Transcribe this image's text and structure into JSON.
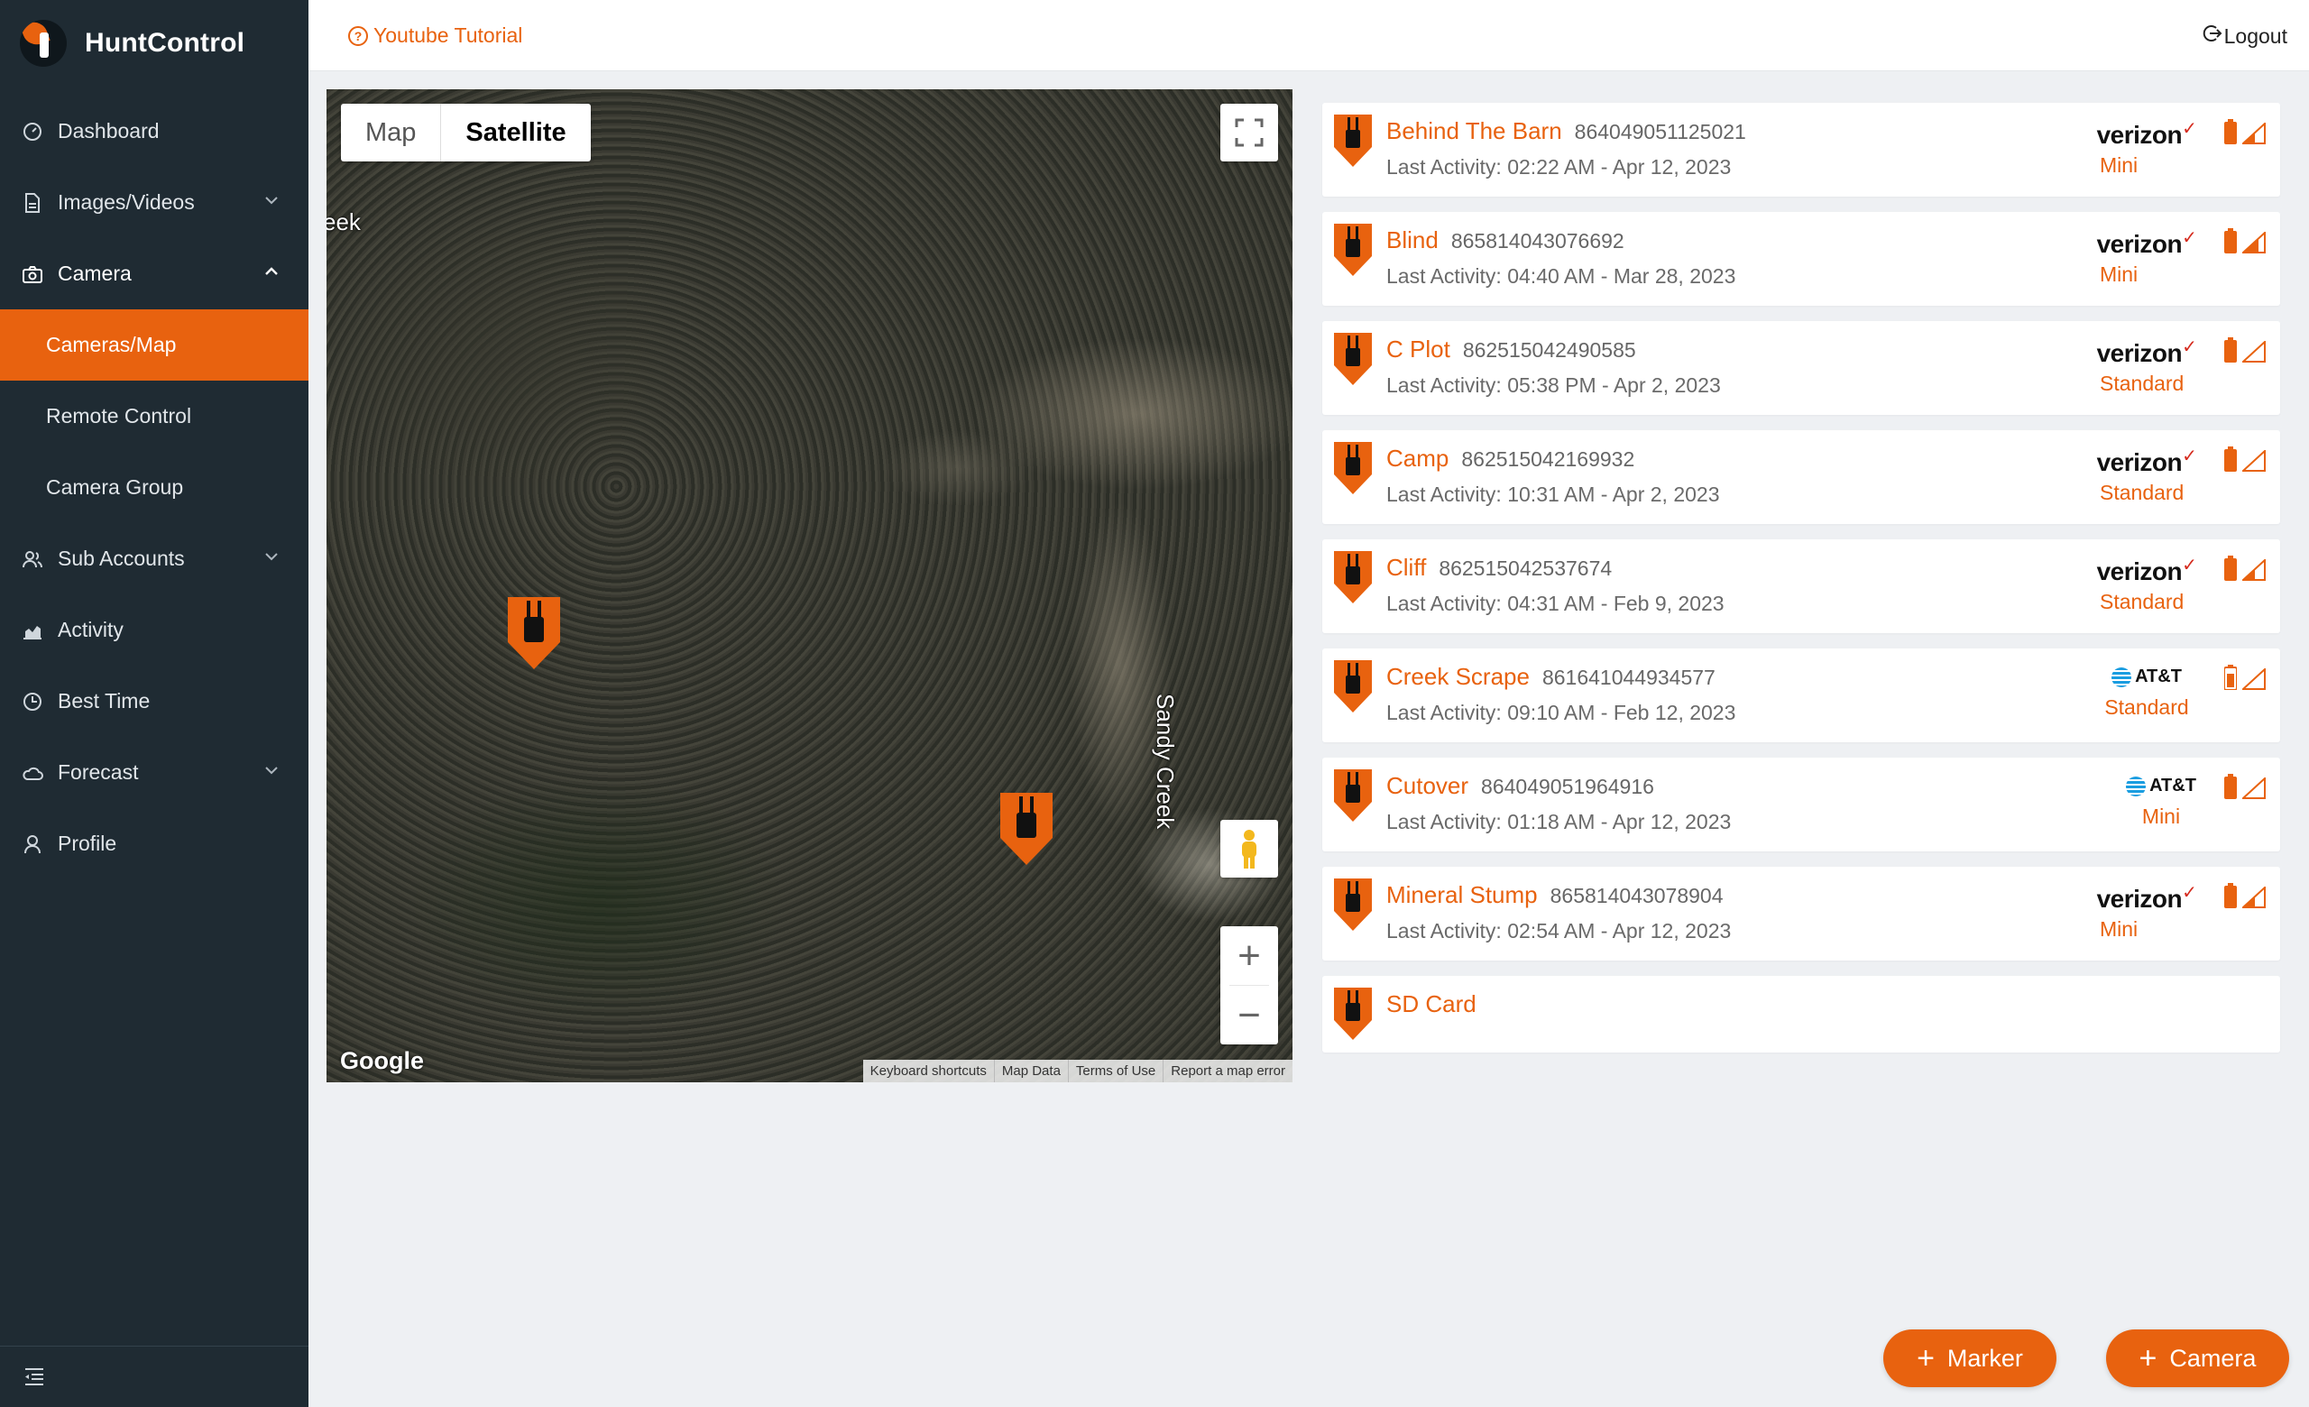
{
  "app": {
    "name": "HuntControl"
  },
  "colors": {
    "accent": "#e8620f",
    "sidebar": "#1f2b33"
  },
  "sidebar": {
    "items": [
      {
        "label": "Dashboard",
        "icon": "dashboard-icon"
      },
      {
        "label": "Images/Videos",
        "icon": "file-icon",
        "expandable": true
      },
      {
        "label": "Camera",
        "icon": "camera-icon",
        "expanded": true
      },
      {
        "label": "Cameras/Map",
        "active": true
      },
      {
        "label": "Remote Control"
      },
      {
        "label": "Camera Group"
      },
      {
        "label": "Sub Accounts",
        "icon": "users-icon",
        "expandable": true
      },
      {
        "label": "Activity",
        "icon": "chart-icon"
      },
      {
        "label": "Best Time",
        "icon": "clock-icon"
      },
      {
        "label": "Forecast",
        "icon": "cloud-icon",
        "expandable": true
      },
      {
        "label": "Profile",
        "icon": "user-icon"
      }
    ]
  },
  "topbar": {
    "tutorial": "Youtube Tutorial",
    "logout": "Logout"
  },
  "map": {
    "type_options": [
      "Map",
      "Satellite"
    ],
    "selected_type": "Satellite",
    "labels": {
      "creek": "eek",
      "sandy": "Sandy Creek"
    },
    "google": "Google",
    "attribution": [
      "Keyboard shortcuts",
      "Map Data",
      "Terms of Use",
      "Report a map error"
    ],
    "zoom_in": "+",
    "zoom_out": "−"
  },
  "cameras": [
    {
      "name": "Behind The Barn",
      "imei": "864049051125021",
      "activity": "Last Activity: 02:22 AM - Apr 12, 2023",
      "carrier": "verizon",
      "plan": "Mini"
    },
    {
      "name": "Blind",
      "imei": "865814043076692",
      "activity": "Last Activity: 04:40 AM - Mar 28, 2023",
      "carrier": "verizon",
      "plan": "Mini"
    },
    {
      "name": "C Plot",
      "imei": "862515042490585",
      "activity": "Last Activity: 05:38 PM - Apr 2, 2023",
      "carrier": "verizon",
      "plan": "Standard"
    },
    {
      "name": "Camp",
      "imei": "862515042169932",
      "activity": "Last Activity: 10:31 AM - Apr 2, 2023",
      "carrier": "verizon",
      "plan": "Standard"
    },
    {
      "name": "Cliff",
      "imei": "862515042537674",
      "activity": "Last Activity: 04:31 AM - Feb 9, 2023",
      "carrier": "verizon",
      "plan": "Standard"
    },
    {
      "name": "Creek Scrape",
      "imei": "861641044934577",
      "activity": "Last Activity: 09:10 AM - Feb 12, 2023",
      "carrier": "AT&T",
      "plan": "Standard"
    },
    {
      "name": "Cutover",
      "imei": "864049051964916",
      "activity": "Last Activity: 01:18 AM - Apr 12, 2023",
      "carrier": "AT&T",
      "plan": "Mini"
    },
    {
      "name": "Mineral Stump",
      "imei": "865814043078904",
      "activity": "Last Activity: 02:54 AM - Apr 12, 2023",
      "carrier": "verizon",
      "plan": "Mini"
    },
    {
      "name": "SD Card"
    }
  ],
  "buttons": {
    "marker": "Marker",
    "camera": "Camera"
  }
}
